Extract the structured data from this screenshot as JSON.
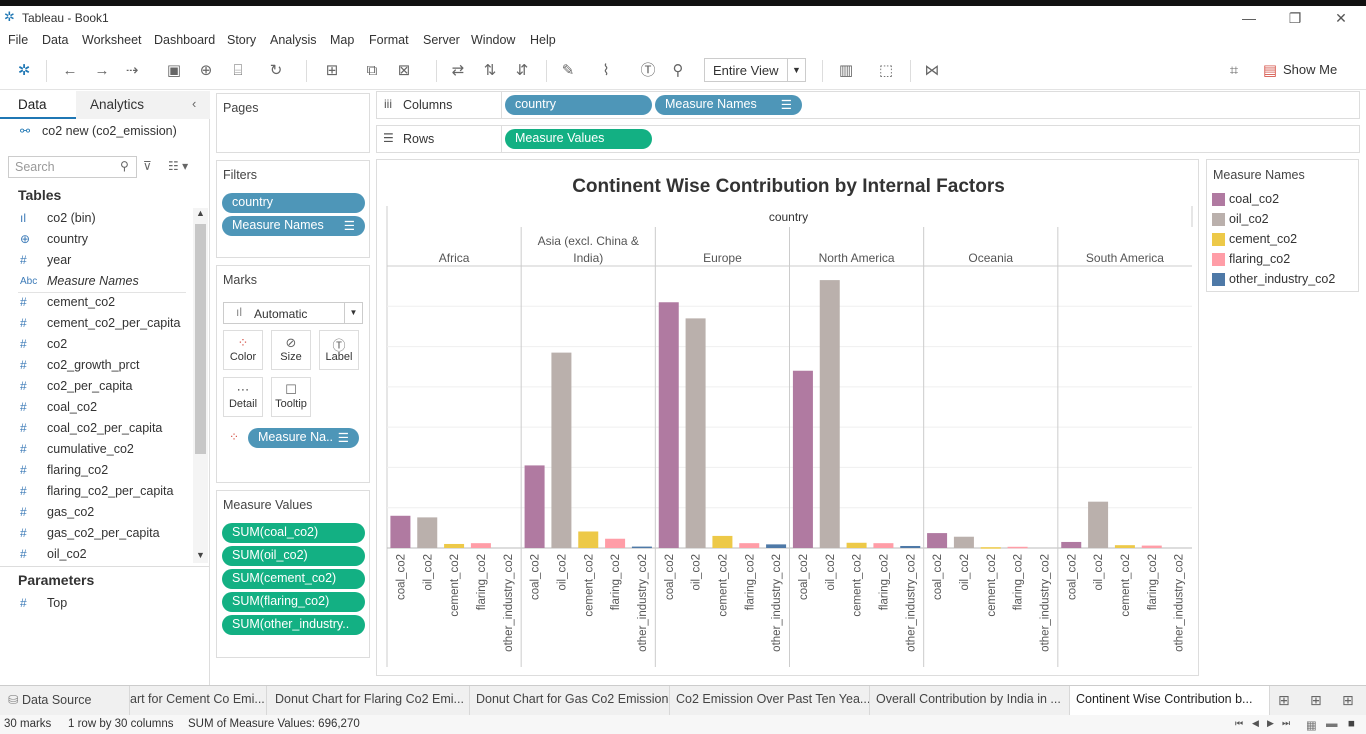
{
  "window": {
    "title": "Tableau - Book1"
  },
  "menu": [
    "File",
    "Data",
    "Worksheet",
    "Dashboard",
    "Story",
    "Analysis",
    "Map",
    "Format",
    "Server",
    "Window",
    "Help"
  ],
  "toolbar": {
    "view_mode": "Entire View",
    "show_me": "Show Me"
  },
  "left": {
    "tab_data": "Data",
    "tab_analytics": "Analytics",
    "datasource": "co2 new (co2_emission)",
    "search_placeholder": "Search",
    "tables_header": "Tables",
    "fields": [
      {
        "icon": "bin",
        "name": "co2 (bin)"
      },
      {
        "icon": "globe",
        "name": "country"
      },
      {
        "icon": "#",
        "name": "year"
      },
      {
        "icon": "Abc",
        "name": "Measure Names"
      },
      {
        "icon": "#",
        "name": "cement_co2"
      },
      {
        "icon": "#",
        "name": "cement_co2_per_capita"
      },
      {
        "icon": "#",
        "name": "co2"
      },
      {
        "icon": "#",
        "name": "co2_growth_prct"
      },
      {
        "icon": "#",
        "name": "co2_per_capita"
      },
      {
        "icon": "#",
        "name": "coal_co2"
      },
      {
        "icon": "#",
        "name": "coal_co2_per_capita"
      },
      {
        "icon": "#",
        "name": "cumulative_co2"
      },
      {
        "icon": "#",
        "name": "flaring_co2"
      },
      {
        "icon": "#",
        "name": "flaring_co2_per_capita"
      },
      {
        "icon": "#",
        "name": "gas_co2"
      },
      {
        "icon": "#",
        "name": "gas_co2_per_capita"
      },
      {
        "icon": "#",
        "name": "oil_co2"
      }
    ],
    "parameters_header": "Parameters",
    "parameters": [
      {
        "icon": "#",
        "name": "Top"
      }
    ]
  },
  "shelves": {
    "pages": "Pages",
    "filters": "Filters",
    "filter_pills": [
      "country",
      "Measure Names"
    ],
    "marks": "Marks",
    "mark_type": "Automatic",
    "mark_buttons": [
      "Color",
      "Size",
      "Label",
      "Detail",
      "Tooltip"
    ],
    "marks_pill": "Measure Na..",
    "measure_values": "Measure Values",
    "measure_pills": [
      "SUM(coal_co2)",
      "SUM(oil_co2)",
      "SUM(cement_co2)",
      "SUM(flaring_co2)",
      "SUM(other_industry.."
    ],
    "columns_label": "Columns",
    "columns_pills": [
      "country",
      "Measure Names"
    ],
    "rows_label": "Rows",
    "rows_pills": [
      "Measure Values"
    ]
  },
  "legend": {
    "title": "Measure Names",
    "items": [
      {
        "name": "coal_co2",
        "color": "#b07aa1"
      },
      {
        "name": "oil_co2",
        "color": "#bab0ac"
      },
      {
        "name": "cement_co2",
        "color": "#edc948"
      },
      {
        "name": "flaring_co2",
        "color": "#ff9da7"
      },
      {
        "name": "other_industry_co2",
        "color": "#4e79a7"
      }
    ]
  },
  "chart_data": {
    "type": "bar",
    "title": "Continent Wise Contribution by Internal Factors",
    "header": "country",
    "panels": [
      "Africa",
      "Asia (excl. China & India)",
      "Europe",
      "North America",
      "Oceania",
      "South America"
    ],
    "categories": [
      "coal_co2",
      "oil_co2",
      "cement_co2",
      "flaring_co2",
      "other_industry_co2"
    ],
    "values": [
      [
        8000,
        7600,
        1000,
        1200,
        0
      ],
      [
        20500,
        48500,
        4100,
        2300,
        350
      ],
      [
        61000,
        57000,
        3000,
        1200,
        900
      ],
      [
        44000,
        66500,
        1300,
        1200,
        500
      ],
      [
        3700,
        2800,
        200,
        300,
        0
      ],
      [
        1500,
        11500,
        700,
        600,
        0
      ]
    ],
    "ylim": [
      0,
      70000
    ],
    "grid": true,
    "legend": "right"
  },
  "sheets": [
    "Data Source",
    "art for Cement Co Emi...",
    "Donut Chart for Flaring Co2 Emi...",
    "Donut Chart for Gas Co2 Emission",
    "Co2 Emission Over Past Ten Yea...",
    "Overall Contribution by India in ...",
    "Continent Wise Contribution b..."
  ],
  "status": {
    "marks": "30 marks",
    "dims": "1 row by 30 columns",
    "sum": "SUM of Measure Values: 696,270"
  }
}
